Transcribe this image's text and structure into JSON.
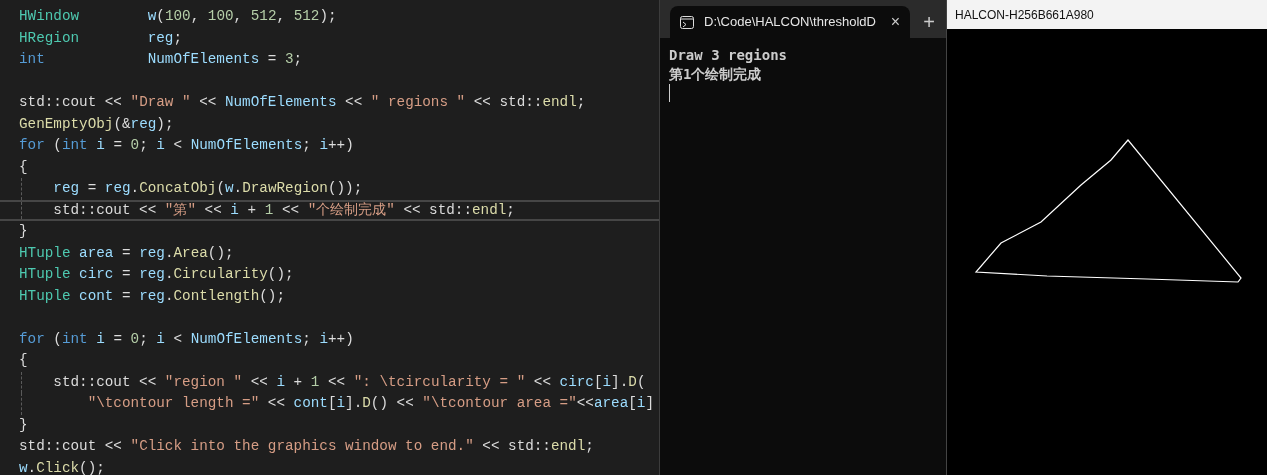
{
  "editor": {
    "lines": [
      {
        "kind": "code",
        "indent_guide": false,
        "current": false,
        "tokens": [
          {
            "kind": "type",
            "text": "HWindow        "
          },
          {
            "kind": "var",
            "text": "w"
          },
          {
            "kind": "plain",
            "text": "("
          },
          {
            "kind": "number",
            "text": "100"
          },
          {
            "kind": "plain",
            "text": ", "
          },
          {
            "kind": "number",
            "text": "100"
          },
          {
            "kind": "plain",
            "text": ", "
          },
          {
            "kind": "number",
            "text": "512"
          },
          {
            "kind": "plain",
            "text": ", "
          },
          {
            "kind": "number",
            "text": "512"
          },
          {
            "kind": "plain",
            "text": ");"
          }
        ]
      },
      {
        "kind": "code",
        "indent_guide": false,
        "current": false,
        "tokens": [
          {
            "kind": "type",
            "text": "HRegion        "
          },
          {
            "kind": "var",
            "text": "reg"
          },
          {
            "kind": "plain",
            "text": ";"
          }
        ]
      },
      {
        "kind": "code",
        "indent_guide": false,
        "current": false,
        "tokens": [
          {
            "kind": "keyword",
            "text": "int            "
          },
          {
            "kind": "var",
            "text": "NumOfElements"
          },
          {
            "kind": "plain",
            "text": " = "
          },
          {
            "kind": "number",
            "text": "3"
          },
          {
            "kind": "plain",
            "text": ";"
          }
        ]
      },
      {
        "kind": "blank"
      },
      {
        "kind": "code",
        "indent_guide": false,
        "current": false,
        "tokens": [
          {
            "kind": "plain",
            "text": "std::cout << "
          },
          {
            "kind": "string",
            "text": "\"Draw \""
          },
          {
            "kind": "plain",
            "text": " << "
          },
          {
            "kind": "var",
            "text": "NumOfElements"
          },
          {
            "kind": "plain",
            "text": " << "
          },
          {
            "kind": "string",
            "text": "\" regions \""
          },
          {
            "kind": "plain",
            "text": " << std::"
          },
          {
            "kind": "func",
            "text": "endl"
          },
          {
            "kind": "plain",
            "text": ";"
          }
        ]
      },
      {
        "kind": "code",
        "indent_guide": false,
        "current": false,
        "tokens": [
          {
            "kind": "func",
            "text": "GenEmptyObj"
          },
          {
            "kind": "plain",
            "text": "(&"
          },
          {
            "kind": "var",
            "text": "reg"
          },
          {
            "kind": "plain",
            "text": ");"
          }
        ]
      },
      {
        "kind": "code",
        "indent_guide": false,
        "current": false,
        "tokens": [
          {
            "kind": "keyword",
            "text": "for"
          },
          {
            "kind": "plain",
            "text": " ("
          },
          {
            "kind": "keyword",
            "text": "int "
          },
          {
            "kind": "var",
            "text": "i"
          },
          {
            "kind": "plain",
            "text": " = "
          },
          {
            "kind": "number",
            "text": "0"
          },
          {
            "kind": "plain",
            "text": "; "
          },
          {
            "kind": "var",
            "text": "i"
          },
          {
            "kind": "plain",
            "text": " < "
          },
          {
            "kind": "var",
            "text": "NumOfElements"
          },
          {
            "kind": "plain",
            "text": "; "
          },
          {
            "kind": "var",
            "text": "i"
          },
          {
            "kind": "plain",
            "text": "++)"
          }
        ]
      },
      {
        "kind": "code",
        "indent_guide": false,
        "current": false,
        "tokens": [
          {
            "kind": "plain",
            "text": "{"
          }
        ]
      },
      {
        "kind": "code",
        "indent_guide": true,
        "current": false,
        "tokens": [
          {
            "kind": "var",
            "text": "    reg"
          },
          {
            "kind": "plain",
            "text": " = "
          },
          {
            "kind": "var",
            "text": "reg"
          },
          {
            "kind": "plain",
            "text": "."
          },
          {
            "kind": "func",
            "text": "ConcatObj"
          },
          {
            "kind": "plain",
            "text": "("
          },
          {
            "kind": "var",
            "text": "w"
          },
          {
            "kind": "plain",
            "text": "."
          },
          {
            "kind": "func",
            "text": "DrawRegion"
          },
          {
            "kind": "plain",
            "text": "());"
          }
        ]
      },
      {
        "kind": "code",
        "indent_guide": true,
        "current": true,
        "tokens": [
          {
            "kind": "plain",
            "text": "    std::cout << "
          },
          {
            "kind": "string",
            "text": "\"第\""
          },
          {
            "kind": "plain",
            "text": " << "
          },
          {
            "kind": "var",
            "text": "i"
          },
          {
            "kind": "plain",
            "text": " + "
          },
          {
            "kind": "number",
            "text": "1"
          },
          {
            "kind": "plain",
            "text": " << "
          },
          {
            "kind": "string",
            "text": "\"个绘制完成\""
          },
          {
            "kind": "plain",
            "text": " << std::"
          },
          {
            "kind": "func",
            "text": "endl"
          },
          {
            "kind": "plain",
            "text": ";"
          }
        ]
      },
      {
        "kind": "code",
        "indent_guide": false,
        "current": false,
        "tokens": [
          {
            "kind": "plain",
            "text": "}"
          }
        ]
      },
      {
        "kind": "code",
        "indent_guide": false,
        "current": false,
        "tokens": [
          {
            "kind": "type",
            "text": "HTuple "
          },
          {
            "kind": "var",
            "text": "area"
          },
          {
            "kind": "plain",
            "text": " = "
          },
          {
            "kind": "var",
            "text": "reg"
          },
          {
            "kind": "plain",
            "text": "."
          },
          {
            "kind": "func",
            "text": "Area"
          },
          {
            "kind": "plain",
            "text": "();"
          }
        ]
      },
      {
        "kind": "code",
        "indent_guide": false,
        "current": false,
        "tokens": [
          {
            "kind": "type",
            "text": "HTuple "
          },
          {
            "kind": "var",
            "text": "circ"
          },
          {
            "kind": "plain",
            "text": " = "
          },
          {
            "kind": "var",
            "text": "reg"
          },
          {
            "kind": "plain",
            "text": "."
          },
          {
            "kind": "func",
            "text": "Circularity"
          },
          {
            "kind": "plain",
            "text": "();"
          }
        ]
      },
      {
        "kind": "code",
        "indent_guide": false,
        "current": false,
        "tokens": [
          {
            "kind": "type",
            "text": "HTuple "
          },
          {
            "kind": "var",
            "text": "cont"
          },
          {
            "kind": "plain",
            "text": " = "
          },
          {
            "kind": "var",
            "text": "reg"
          },
          {
            "kind": "plain",
            "text": "."
          },
          {
            "kind": "func",
            "text": "Contlength"
          },
          {
            "kind": "plain",
            "text": "();"
          }
        ]
      },
      {
        "kind": "blank"
      },
      {
        "kind": "code",
        "indent_guide": false,
        "current": false,
        "tokens": [
          {
            "kind": "keyword",
            "text": "for"
          },
          {
            "kind": "plain",
            "text": " ("
          },
          {
            "kind": "keyword",
            "text": "int "
          },
          {
            "kind": "var",
            "text": "i"
          },
          {
            "kind": "plain",
            "text": " = "
          },
          {
            "kind": "number",
            "text": "0"
          },
          {
            "kind": "plain",
            "text": "; "
          },
          {
            "kind": "var",
            "text": "i"
          },
          {
            "kind": "plain",
            "text": " < "
          },
          {
            "kind": "var",
            "text": "NumOfElements"
          },
          {
            "kind": "plain",
            "text": "; "
          },
          {
            "kind": "var",
            "text": "i"
          },
          {
            "kind": "plain",
            "text": "++)"
          }
        ]
      },
      {
        "kind": "code",
        "indent_guide": false,
        "current": false,
        "tokens": [
          {
            "kind": "plain",
            "text": "{"
          }
        ]
      },
      {
        "kind": "code",
        "indent_guide": true,
        "current": false,
        "tokens": [
          {
            "kind": "plain",
            "text": "    std::cout << "
          },
          {
            "kind": "string",
            "text": "\"region \""
          },
          {
            "kind": "plain",
            "text": " << "
          },
          {
            "kind": "var",
            "text": "i"
          },
          {
            "kind": "plain",
            "text": " + "
          },
          {
            "kind": "number",
            "text": "1"
          },
          {
            "kind": "plain",
            "text": " << "
          },
          {
            "kind": "string",
            "text": "\": \\tcircularity = \""
          },
          {
            "kind": "plain",
            "text": " << "
          },
          {
            "kind": "var",
            "text": "circ"
          },
          {
            "kind": "plain",
            "text": "["
          },
          {
            "kind": "var",
            "text": "i"
          },
          {
            "kind": "plain",
            "text": "]."
          },
          {
            "kind": "func",
            "text": "D"
          },
          {
            "kind": "plain",
            "text": "("
          }
        ]
      },
      {
        "kind": "code",
        "indent_guide": true,
        "current": false,
        "tokens": [
          {
            "kind": "string",
            "text": "        \"\\tcontour length =\""
          },
          {
            "kind": "plain",
            "text": " << "
          },
          {
            "kind": "var",
            "text": "cont"
          },
          {
            "kind": "plain",
            "text": "["
          },
          {
            "kind": "var",
            "text": "i"
          },
          {
            "kind": "plain",
            "text": "]."
          },
          {
            "kind": "func",
            "text": "D"
          },
          {
            "kind": "plain",
            "text": "() << "
          },
          {
            "kind": "string",
            "text": "\"\\tcontour area =\""
          },
          {
            "kind": "plain",
            "text": "<<"
          },
          {
            "kind": "var",
            "text": "area"
          },
          {
            "kind": "plain",
            "text": "["
          },
          {
            "kind": "var",
            "text": "i"
          },
          {
            "kind": "plain",
            "text": "]"
          }
        ]
      },
      {
        "kind": "code",
        "indent_guide": false,
        "current": false,
        "tokens": [
          {
            "kind": "plain",
            "text": "}"
          }
        ]
      },
      {
        "kind": "code",
        "indent_guide": false,
        "current": false,
        "tokens": [
          {
            "kind": "plain",
            "text": "std::cout << "
          },
          {
            "kind": "string",
            "text": "\"Click into the graphics window to end.\""
          },
          {
            "kind": "plain",
            "text": " << std::"
          },
          {
            "kind": "func",
            "text": "endl"
          },
          {
            "kind": "plain",
            "text": ";"
          }
        ]
      },
      {
        "kind": "code",
        "indent_guide": false,
        "current": false,
        "tokens": [
          {
            "kind": "var",
            "text": "w"
          },
          {
            "kind": "plain",
            "text": "."
          },
          {
            "kind": "func",
            "text": "Click"
          },
          {
            "kind": "plain",
            "text": "();"
          }
        ]
      }
    ]
  },
  "terminal": {
    "tab": {
      "title": "D:\\Code\\HALCON\\thresholdD",
      "selected": true,
      "close": "×"
    },
    "new_tab": "+",
    "lines": [
      "Draw 3 regions",
      "第1个绘制完成"
    ],
    "cursor": true
  },
  "graphics_window": {
    "title": "HALCON-H256B661A980"
  }
}
